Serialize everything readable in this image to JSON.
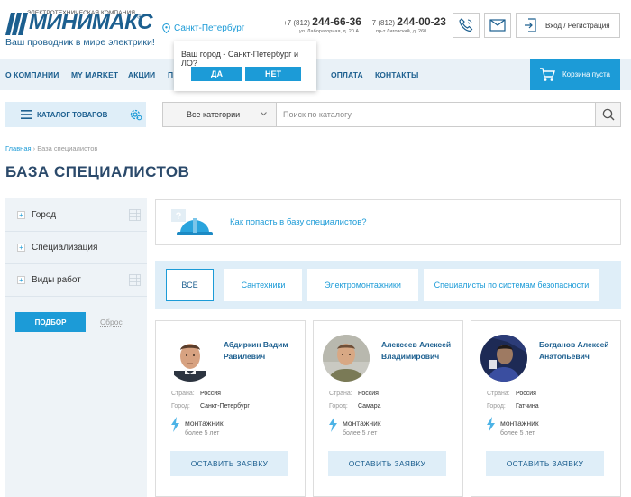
{
  "header": {
    "logo_top": "ЭЛЕКТРОТЕХНИЧЕСКАЯ КОМПАНИЯ",
    "logo_word": "МИНИМАКС",
    "logo_reg": "®",
    "slogan": "Ваш проводник в мире электрики!",
    "city": "Санкт-Петербург",
    "phones": [
      {
        "prefix": "+7 (812)",
        "number": "244-66-36",
        "address": "ул. Лабораторная, д. 20 А"
      },
      {
        "prefix": "+7 (812)",
        "number": "244-00-23",
        "address": "пр-т Лиговский, д. 260"
      }
    ],
    "login": "Вход / Регистрация"
  },
  "nav": {
    "items": [
      "О КОМПАНИИ",
      "MY MARKET",
      "АКЦИИ",
      "П",
      "ОПЛАТА",
      "КОНТАКТЫ"
    ],
    "cart": "Корзина пуста"
  },
  "popup": {
    "question": "Ваш город - Санкт-Петербург и ЛО?",
    "yes": "ДА",
    "no": "НЕТ"
  },
  "catalog": {
    "button": "КАТАЛОГ ТОВАРОВ",
    "category": "Все категории",
    "search_placeholder": "Поиск по каталогу"
  },
  "breadcrumb": {
    "home": "Главная",
    "sep": " › ",
    "current": "База специалистов"
  },
  "page_title": "БАЗА СПЕЦИАЛИСТОВ",
  "filters": {
    "items": [
      "Город",
      "Специализация",
      "Виды работ"
    ],
    "pick": "ПОДБОР",
    "reset": "Сброс"
  },
  "info": {
    "text": "Как попасть в базу специалистов?"
  },
  "tabs": [
    "ВСЕ",
    "Сантехники",
    "Электромонтажники",
    "Специалисты по системам безопасности"
  ],
  "labels": {
    "country": "Страна:",
    "city": "Город:"
  },
  "cards": [
    {
      "name1": "Абдиркин Вадим",
      "name2": "Равилевич",
      "country": "Россия",
      "city": "Санкт-Петербург",
      "spec": "монтажник",
      "exp": "более 5 лет",
      "button": "ОСТАВИТЬ ЗАЯВКУ"
    },
    {
      "name1": "Алексеев Алексей",
      "name2": "Владимирович",
      "country": "Россия",
      "city": "Самара",
      "spec": "монтажник",
      "exp": "более 5 лет",
      "button": "ОСТАВИТЬ ЗАЯВКУ"
    },
    {
      "name1": "Богданов Алексей",
      "name2": "Анатольевич",
      "country": "Россия",
      "city": "Гатчина",
      "spec": "монтажник",
      "exp": "более 5 лет",
      "button": "ОСТАВИТЬ ЗАЯВКУ"
    }
  ],
  "colors": {
    "accent": "#1c9bd7",
    "brand": "#1c5f8f",
    "light": "#dfeef8"
  }
}
